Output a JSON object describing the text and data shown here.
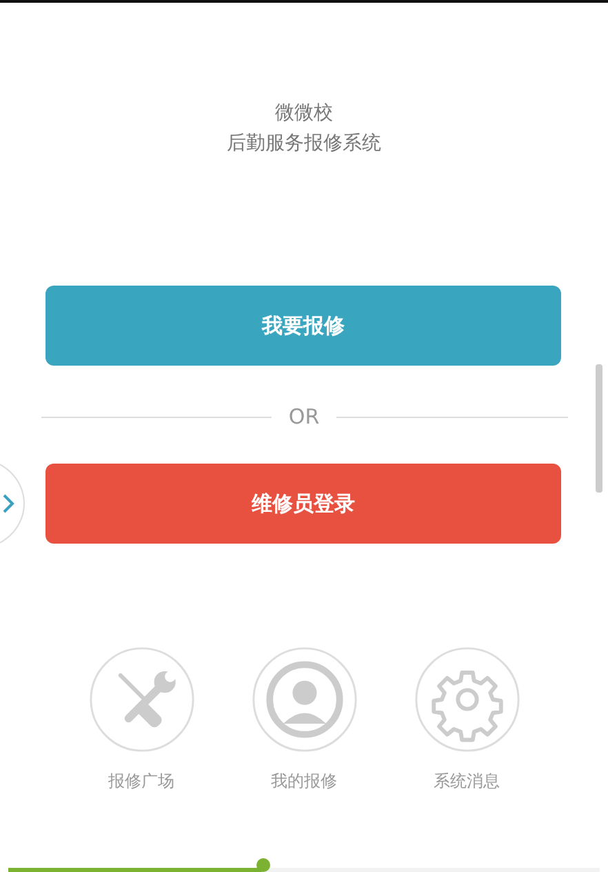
{
  "header": {
    "title": "微微校",
    "subtitle": "后勤服务报修系统"
  },
  "actions": [
    {
      "label": "我要报修",
      "kind": "primary"
    },
    {
      "label": "维修员登录",
      "kind": "danger"
    }
  ],
  "divider": "OR",
  "shortcuts": [
    {
      "label": "报修广场",
      "kind": "tools"
    },
    {
      "label": "我的报修",
      "kind": "user"
    },
    {
      "label": "系统消息",
      "kind": "gear"
    }
  ],
  "progress": {
    "level": 0.43
  }
}
